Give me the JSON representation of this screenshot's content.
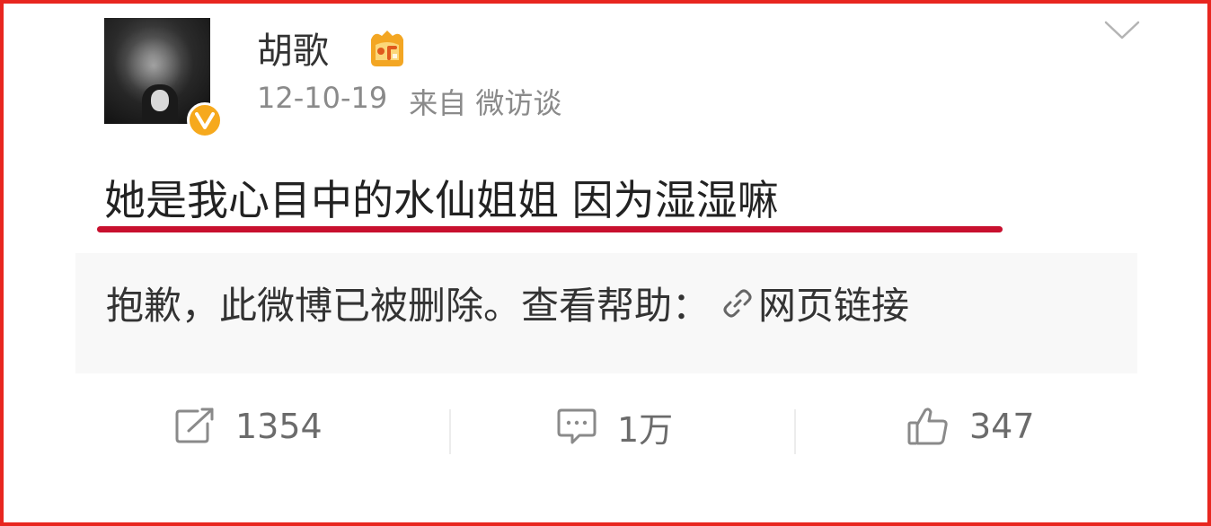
{
  "post": {
    "username": "胡歌",
    "date": "12-10-19",
    "source": "来自 微访谈",
    "text": "她是我心目中的水仙姐姐 因为湿湿嘛",
    "deleted_notice": "抱歉，此微博已被删除。查看帮助：",
    "help_link": "网页链接"
  },
  "actions": {
    "repost_count": "1354",
    "comment_count": "1万",
    "like_count": "347"
  },
  "colors": {
    "frame": "#e8261f",
    "underline": "#c8102e",
    "verified": "#f6a91d"
  },
  "icons": [
    "avatar",
    "verified-badge-icon",
    "member-crown-icon",
    "chevron-down-icon",
    "link-icon",
    "repost-icon",
    "comment-icon",
    "like-icon"
  ]
}
